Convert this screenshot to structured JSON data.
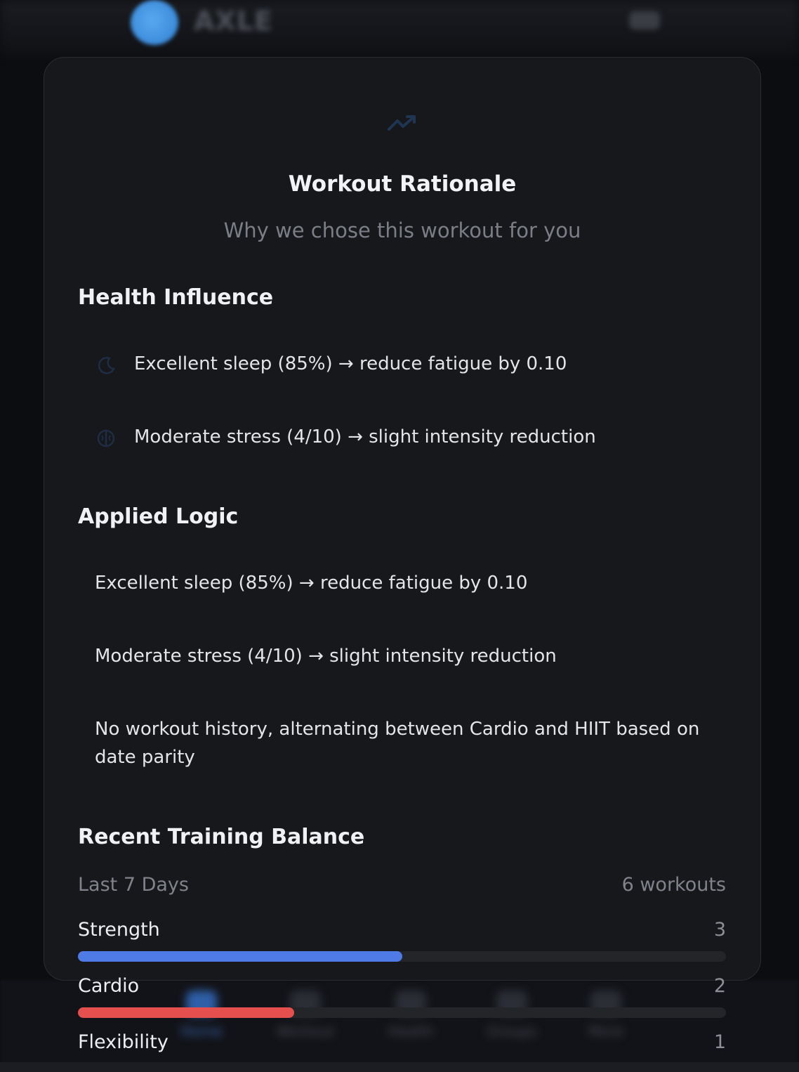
{
  "background": {
    "app_name": "AXLE",
    "nav": [
      {
        "label": "Home"
      },
      {
        "label": "Workout"
      },
      {
        "label": "Health"
      },
      {
        "label": "Groups"
      },
      {
        "label": "More"
      }
    ]
  },
  "modal": {
    "title": "Workout Rationale",
    "subtitle": "Why we chose this workout for you",
    "icon": "trending-up-icon",
    "health_influence": {
      "heading": "Health Influence",
      "items": [
        {
          "icon": "moon-icon",
          "text": "Excellent sleep (85%) → reduce fatigue by 0.10"
        },
        {
          "icon": "brain-icon",
          "text": "Moderate stress (4/10) → slight intensity reduction"
        }
      ]
    },
    "applied_logic": {
      "heading": "Applied Logic",
      "items": [
        "Excellent sleep (85%) → reduce fatigue by 0.10",
        "Moderate stress (4/10) → slight intensity reduction",
        "No workout history, alternating between Cardio and HIIT based on date parity"
      ]
    },
    "training_balance": {
      "heading": "Recent Training Balance",
      "period": "Last 7 Days",
      "total": "6 workouts",
      "max": 6,
      "bars": [
        {
          "label": "Strength",
          "count": "3",
          "value": 3,
          "color": "#4f7be6"
        },
        {
          "label": "Cardio",
          "count": "2",
          "value": 2,
          "color": "#e5504e"
        },
        {
          "label": "Flexibility",
          "count": "1",
          "value": 1,
          "color": "#3fb56b"
        }
      ]
    }
  }
}
